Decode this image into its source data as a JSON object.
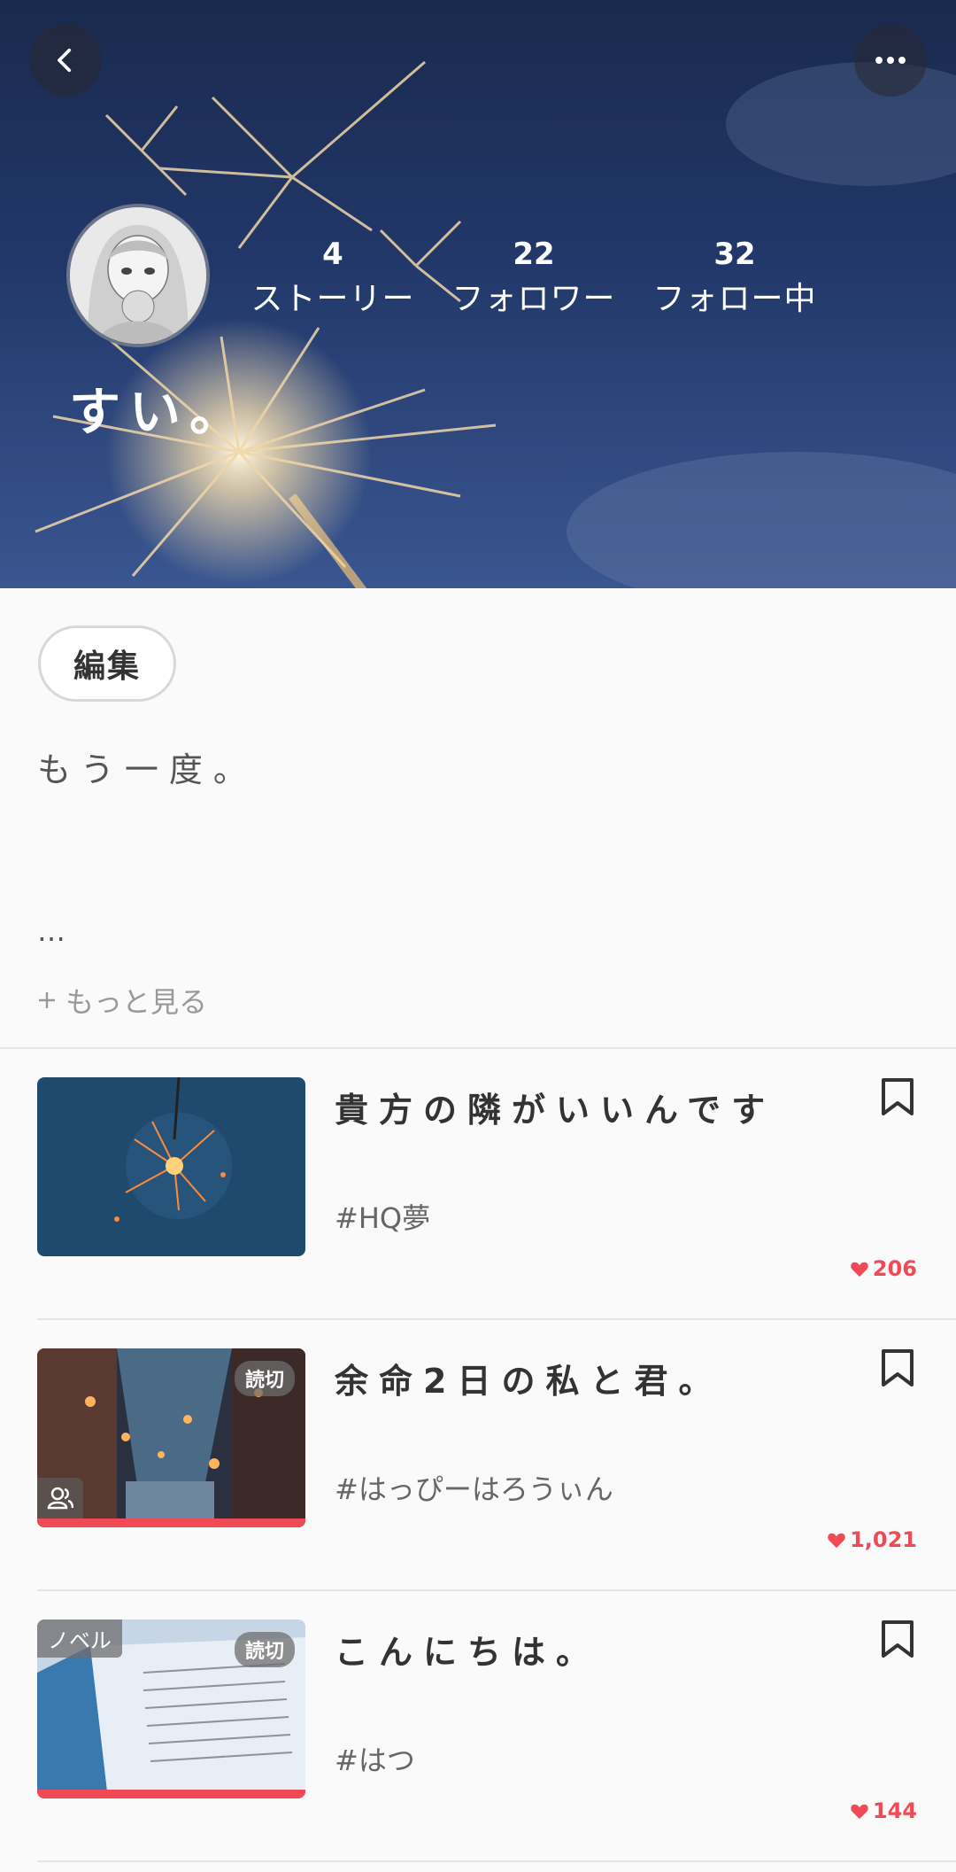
{
  "header": {
    "username": "すい。",
    "stats": [
      {
        "value": "4",
        "label": "ストーリー"
      },
      {
        "value": "22",
        "label": "フォロワー"
      },
      {
        "value": "32",
        "label": "フォロー中"
      }
    ],
    "icons": {
      "back": "chevron-left-icon",
      "more": "ellipsis-icon"
    }
  },
  "profile": {
    "edit_label": "編集",
    "bio": "もう一度。",
    "ellipsis": "…",
    "more_label": "もっと見る"
  },
  "stories": [
    {
      "title": "貴方の隣がいいんです",
      "tag": "#HQ夢",
      "likes": "206",
      "badge": "",
      "corner_label": ""
    },
    {
      "title": "余命2日の私と君。",
      "tag": "#はっぴーはろうぃん",
      "likes": "1,021",
      "badge": "読切",
      "corner_label": ""
    },
    {
      "title": "こんにちは。",
      "tag": "#はつ",
      "likes": "144",
      "badge": "読切",
      "corner_label": "ノベル"
    }
  ],
  "colors": {
    "accent": "#ef4a55",
    "cover_top": "#1a2a4e",
    "cover_bottom": "#3a5690"
  }
}
